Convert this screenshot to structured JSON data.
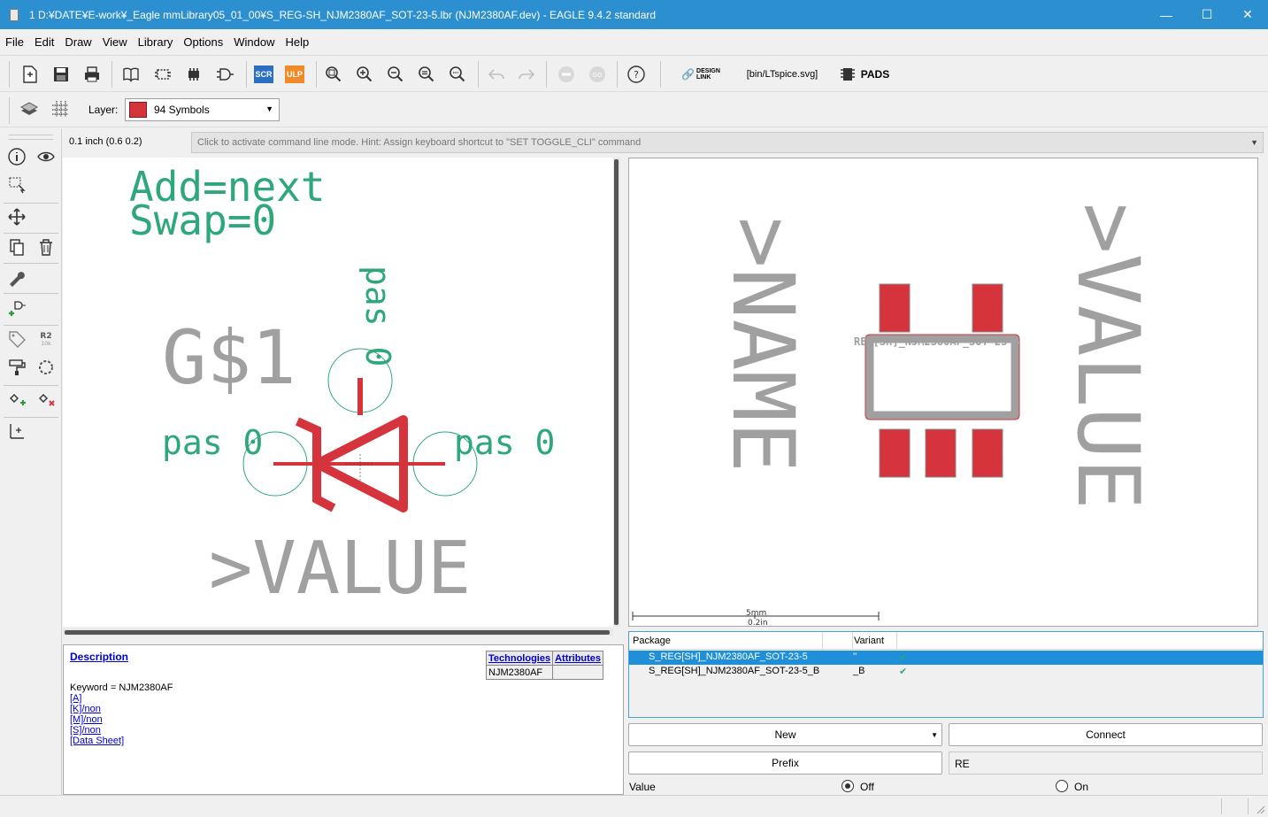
{
  "window": {
    "title": "1 D:¥DATE¥E-work¥_Eagle mmLibrary05_01_00¥S_REG-SH_NJM2380AF_SOT-23-5.lbr (NJM2380AF.dev) - EAGLE 9.4.2 standard"
  },
  "menu": [
    "File",
    "Edit",
    "Draw",
    "View",
    "Library",
    "Options",
    "Window",
    "Help"
  ],
  "toolbar": {
    "scr_label": "SCR",
    "ulp_label": "ULP",
    "design_link_line1": "DESIGN",
    "design_link_line2": "LINK",
    "script_combo": "[bin/LTspice.svg]",
    "pads_label": "PADS"
  },
  "layer": {
    "label": "Layer:",
    "selected": "94 Symbols",
    "color": "#d6343c"
  },
  "coords": "0.1 inch (0.6 0.2)",
  "command_hint": "Click to activate command line mode. Hint: Assign keyboard shortcut to \"SET TOGGLE_CLI\" command",
  "symbol": {
    "attr_line1": "Add=next",
    "attr_line2": "Swap=0",
    "name": "G$1",
    "value": ">VALUE",
    "pin_top": "pas 0",
    "pin_left": "pas 0",
    "pin_right": "pas 0"
  },
  "package_view": {
    "name": ">NAME",
    "value": ">VALUE",
    "package_text": "REG[SH]_NJM2380AF_SOT-23-5",
    "scale_mm": "5mm",
    "scale_in": "0.2in"
  },
  "description": {
    "header": "Description",
    "keyword": "Keyword = NJM2380AF",
    "links": [
      "[A]",
      "[K]/non",
      "[M]/non",
      "[S]/non",
      "[Data Sheet]"
    ],
    "tech_header": "Technologies",
    "attr_header": "Attributes",
    "tech_value": "NJM2380AF"
  },
  "packages": {
    "col_package": "Package",
    "col_variant": "Variant",
    "rows": [
      {
        "name": "S_REG[SH]_NJM2380AF_SOT-23-5",
        "variant": "''",
        "selected": true
      },
      {
        "name": "S_REG[SH]_NJM2380AF_SOT-23-5_B",
        "variant": "_B",
        "selected": false
      }
    ]
  },
  "buttons": {
    "new": "New",
    "connect": "Connect",
    "prefix": "Prefix",
    "prefix_value": "RE"
  },
  "value_option": {
    "label": "Value",
    "off": "Off",
    "on": "On",
    "selected": "Off"
  },
  "colors": {
    "accent": "#2c8fd0",
    "symbol_green": "#2ea87a",
    "symbol_red": "#d6343c",
    "gray_text": "#a0a0a0"
  }
}
